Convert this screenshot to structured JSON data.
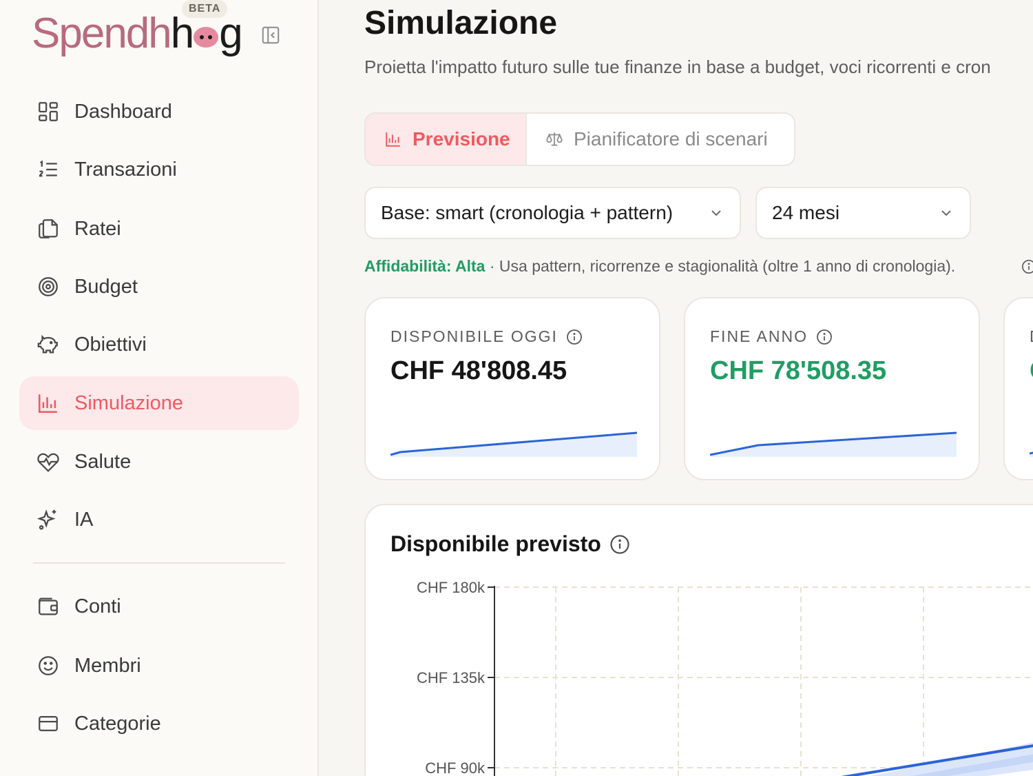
{
  "app": {
    "brand_main": "Spendh",
    "brand_dark": "g",
    "badge": "BETA"
  },
  "sidebar": {
    "items": [
      {
        "label": "Dashboard",
        "icon": "dashboard-icon"
      },
      {
        "label": "Transazioni",
        "icon": "numbered-list-icon"
      },
      {
        "label": "Ratei",
        "icon": "documents-icon"
      },
      {
        "label": "Budget",
        "icon": "target-icon"
      },
      {
        "label": "Obiettivi",
        "icon": "piggy-bank-icon"
      },
      {
        "label": "Simulazione",
        "icon": "bar-chart-icon",
        "active": true
      },
      {
        "label": "Salute",
        "icon": "heart-pulse-icon"
      },
      {
        "label": "IA",
        "icon": "sparkles-icon"
      }
    ],
    "secondary": [
      {
        "label": "Conti",
        "icon": "wallet-icon"
      },
      {
        "label": "Membri",
        "icon": "smiley-icon"
      },
      {
        "label": "Categorie",
        "icon": "card-icon"
      }
    ]
  },
  "page": {
    "title": "Simulazione",
    "subtitle": "Proietta l'impatto futuro sulle tue finanze in base a budget, voci ricorrenti e cron"
  },
  "tabs": [
    {
      "label": "Previsione",
      "icon": "bar-chart-icon",
      "active": true
    },
    {
      "label": "Pianificatore di scenari",
      "icon": "scale-icon",
      "active": false
    }
  ],
  "filters": {
    "base": "Base: smart (cronologia + pattern)",
    "horizon": "24 mesi"
  },
  "reliability": {
    "label": "Affidabilità: Alta",
    "text": " · Usa pattern, ricorrenze e stagionalità (oltre 1 anno di cronologia)."
  },
  "cards": [
    {
      "label": "DISPONIBILE OGGI",
      "value": "CHF 48'808.45",
      "value_color": "#161616"
    },
    {
      "label": "FINE ANNO",
      "value": "CHF 78'508.35",
      "value_color": "#1f9d63"
    },
    {
      "label": "D",
      "value": "C",
      "value_color": "#1f9d63"
    }
  ],
  "chart": {
    "title": "Disponibile previsto",
    "ytick_labels": [
      "CHF 180k",
      "CHF 135k",
      "CHF 90k"
    ]
  },
  "chart_data": {
    "type": "area",
    "title": "Disponibile previsto",
    "ylabel": "",
    "yticks": [
      180000,
      135000,
      90000
    ],
    "ylim": [
      90000,
      180000
    ],
    "series": [
      {
        "values": [
          48808,
          78508
        ],
        "color": "#2563eb"
      }
    ],
    "grid": true
  },
  "colors": {
    "accent": "#ef5a5f",
    "accent_bg": "#fde8ea",
    "positive": "#1f9d63",
    "line": "#2563eb"
  }
}
